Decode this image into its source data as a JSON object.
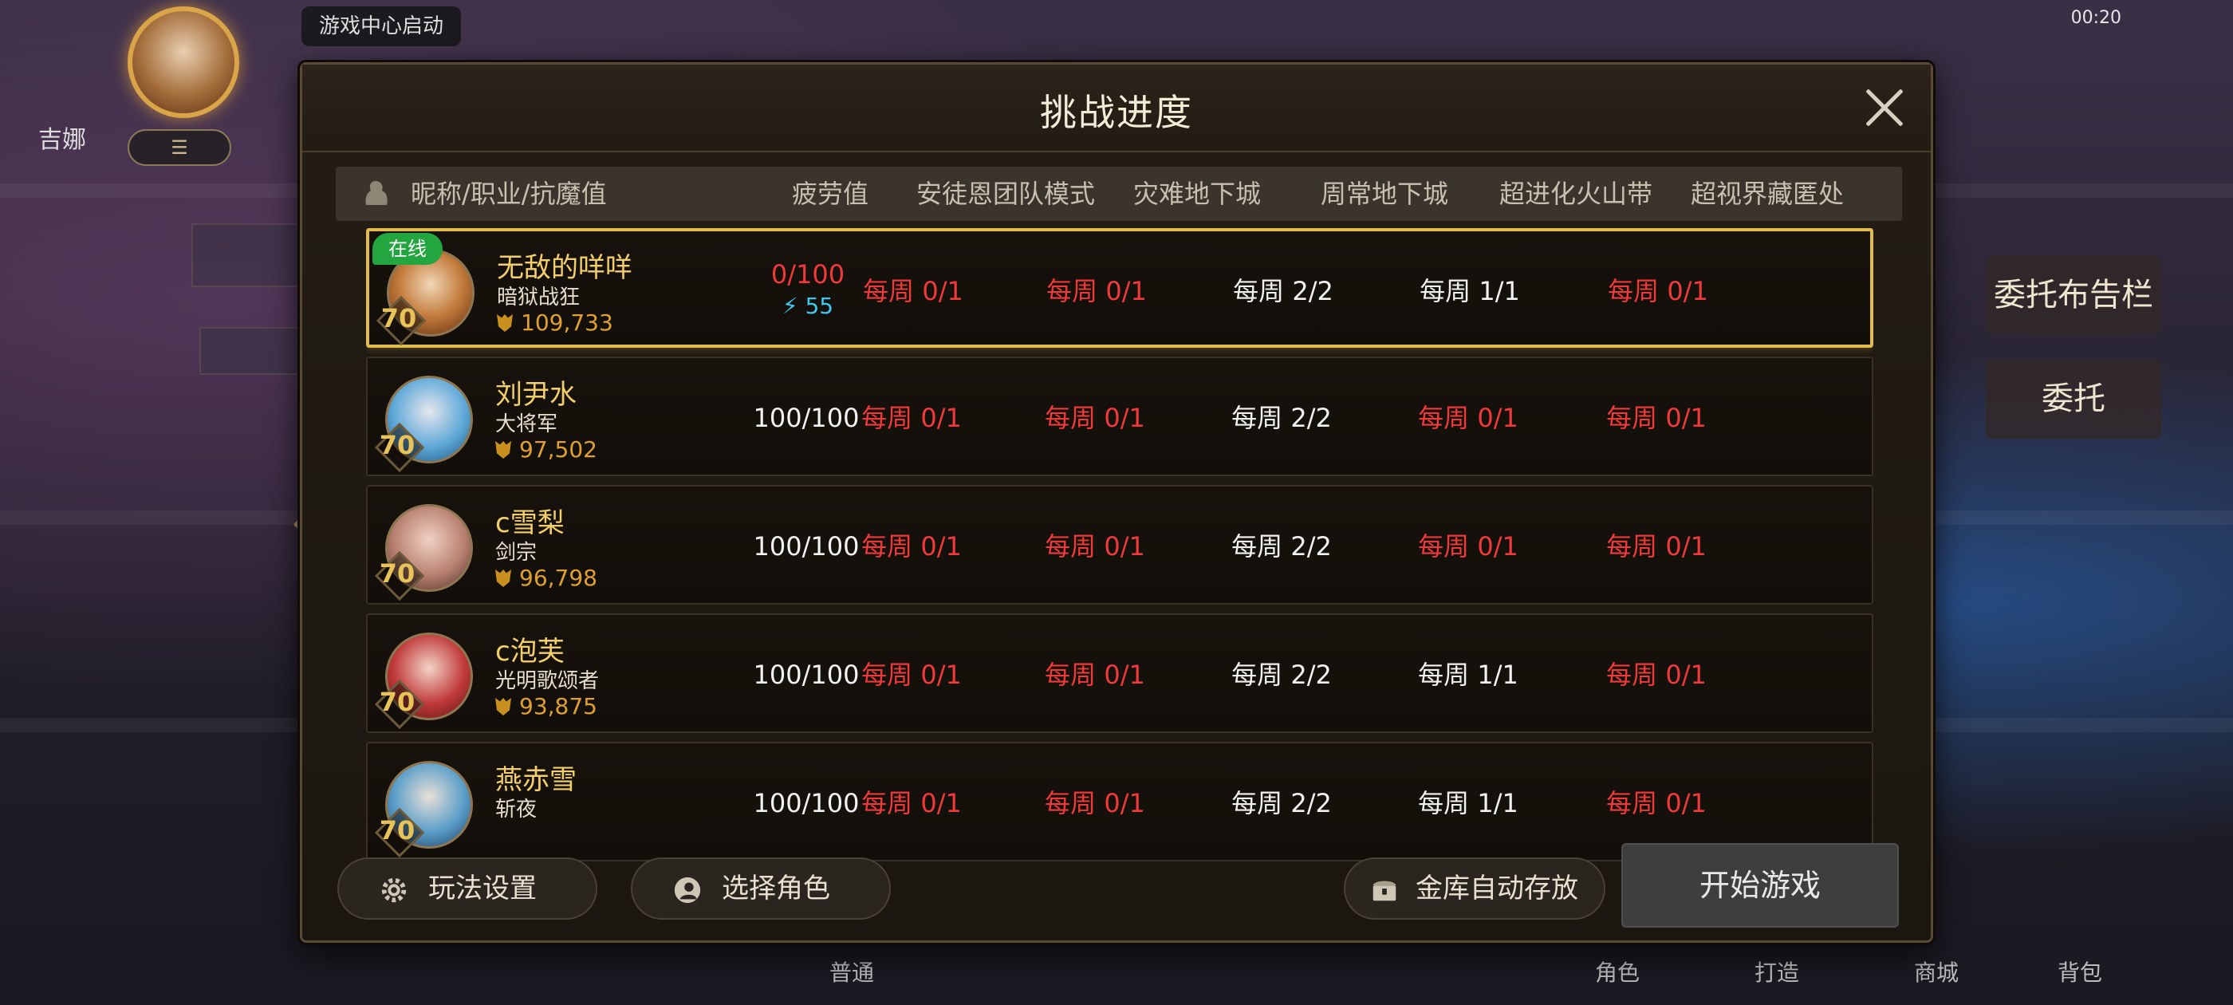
{
  "status_bar": {
    "time": "00:20"
  },
  "background": {
    "hud_player_name": "吉娜",
    "hud_tag": "游戏中心启动",
    "side_labels": [
      "委托布告栏",
      "委托"
    ],
    "bottom_labels": [
      "普通",
      "角色",
      "打造",
      "商城",
      "背包"
    ]
  },
  "modal": {
    "title": "挑战进度",
    "columns": [
      "昵称/职业/抗魔值",
      "疲劳值",
      "安徒恩团队模式",
      "灾难地下城",
      "周常地下城",
      "超进化火山带",
      "超视界藏匿处"
    ],
    "rows": [
      {
        "name": "无敌的咩咩",
        "class": "暗狱战狂",
        "power": "109,733",
        "level": "70",
        "online": "在线",
        "fatigue": "0/100",
        "fatigue_extra": "55",
        "cells": [
          "每周 0/1",
          "每周 0/1",
          "每周 2/2",
          "每周 1/1",
          "每周 0/1"
        ],
        "cell_colors": [
          "red",
          "red",
          "white",
          "white",
          "red"
        ],
        "selected": true
      },
      {
        "name": "刘尹水",
        "class": "大将军",
        "power": "97,502",
        "level": "70",
        "fatigue": "100/100",
        "cells": [
          "每周 0/1",
          "每周 0/1",
          "每周 2/2",
          "每周 0/1",
          "每周 0/1"
        ],
        "cell_colors": [
          "red",
          "red",
          "white",
          "red",
          "red"
        ]
      },
      {
        "name": "c雪梨",
        "class": "剑宗",
        "power": "96,798",
        "level": "70",
        "fatigue": "100/100",
        "cells": [
          "每周 0/1",
          "每周 0/1",
          "每周 2/2",
          "每周 0/1",
          "每周 0/1"
        ],
        "cell_colors": [
          "red",
          "red",
          "white",
          "red",
          "red"
        ]
      },
      {
        "name": "c泡芙",
        "class": "光明歌颂者",
        "power": "93,875",
        "level": "70",
        "fatigue": "100/100",
        "cells": [
          "每周 0/1",
          "每周 0/1",
          "每周 2/2",
          "每周 1/1",
          "每周 0/1"
        ],
        "cell_colors": [
          "red",
          "red",
          "white",
          "white",
          "red"
        ]
      },
      {
        "name": "燕赤雪",
        "class": "斩夜",
        "power": "",
        "level": "70",
        "fatigue": "100/100",
        "cells": [
          "每周 0/1",
          "每周 0/1",
          "每周 2/2",
          "每周 1/1",
          "每周 0/1"
        ],
        "cell_colors": [
          "red",
          "red",
          "white",
          "white",
          "red"
        ]
      }
    ],
    "buttons": {
      "settings": "玩法设置",
      "select_role": "选择角色",
      "auto_store": "金库自动存放",
      "start": "开始游戏"
    }
  },
  "colors": {
    "accent_gold": "#e3bd4c",
    "red_text": "#f03a3a",
    "cyan_text": "#3ec7ee",
    "online_green": "#23a63f"
  }
}
